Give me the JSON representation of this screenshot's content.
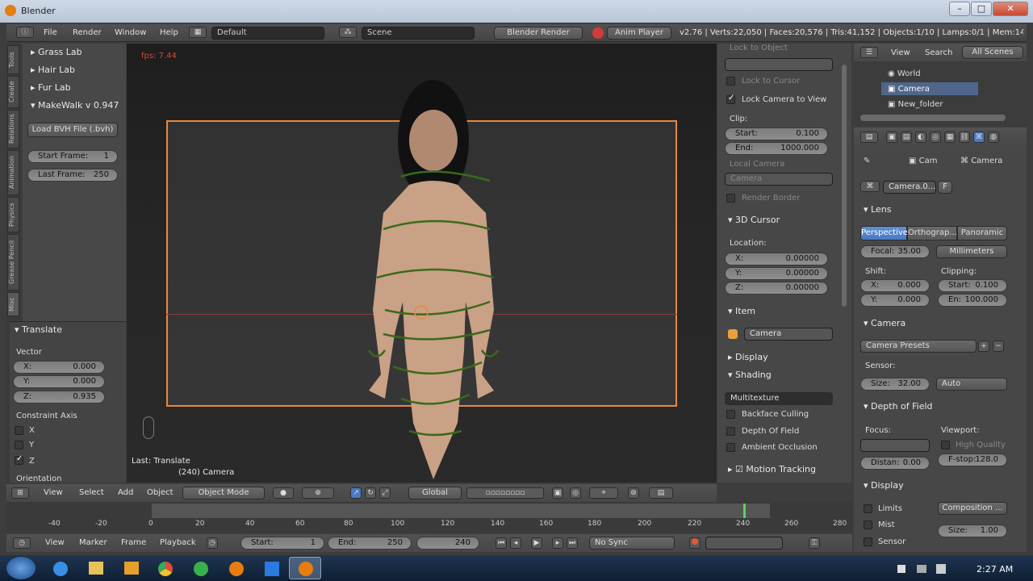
{
  "window": {
    "title": "Blender",
    "controls": [
      "–",
      "□",
      "✕"
    ]
  },
  "infobar": {
    "menus": [
      "File",
      "Render",
      "Window",
      "Help"
    ],
    "screen": "Default",
    "scene": "Scene",
    "engine": "Blender Render",
    "anim_player": "Anim Player",
    "stats": "v2.76 | Verts:22,050 | Faces:20,576 | Tris:41,152 | Objects:1/10 | Lamps:0/1 | Mem:14"
  },
  "tool_tabs": [
    "Tools",
    "Create",
    "Relations",
    "Animation",
    "Physics",
    "Grease Pencil",
    "Misc"
  ],
  "toolshelf": {
    "panels": [
      "Grass Lab",
      "Hair Lab",
      "Fur Lab",
      "MakeWalk v 0.947"
    ],
    "load_bvh": "Load BVH File (.bvh)",
    "start_frame_label": "Start Frame:",
    "start_frame": "1",
    "last_frame_label": "Last Frame:",
    "last_frame": "250"
  },
  "operator": {
    "title": "Translate",
    "vector_label": "Vector",
    "x_label": "X:",
    "x": "0.000",
    "y_label": "Y:",
    "y": "0.000",
    "z_label": "Z:",
    "z": "0.935",
    "constraint_label": "Constraint Axis",
    "axes": [
      "X",
      "Y",
      "Z"
    ],
    "orientation_label": "Orientation"
  },
  "viewport": {
    "fps": "fps: 7.44",
    "last_op": "Last: Translate",
    "object_label": "(240) Camera"
  },
  "view_header": {
    "menus": [
      "View",
      "Select",
      "Add",
      "Object"
    ],
    "mode": "Object Mode",
    "orientation": "Global"
  },
  "npanel": {
    "lock_to_object": "Lock to Object",
    "lock_to_cursor": "Lock to Cursor",
    "lock_camera": "Lock Camera to View",
    "clip_label": "Clip:",
    "start_label": "Start:",
    "start": "0.100",
    "end_label": "End:",
    "end": "1000.000",
    "local_camera": "Local Camera",
    "camera_field": "Camera",
    "render_border": "Render Border",
    "cursor_title": "3D Cursor",
    "location_label": "Location:",
    "cx_label": "X:",
    "cx": "0.00000",
    "cy_label": "Y:",
    "cy": "0.00000",
    "cz_label": "Z:",
    "cz": "0.00000",
    "item_title": "Item",
    "item_name": "Camera",
    "display_title": "Display",
    "shading_title": "Shading",
    "shading_mode": "Multitexture",
    "backface": "Backface Culling",
    "dof": "Depth Of Field",
    "ao": "Ambient Occlusion",
    "motion": "Motion Tracking"
  },
  "outliner": {
    "menus": [
      "View",
      "Search"
    ],
    "scope": "All Scenes",
    "items": [
      "World",
      "Camera",
      "New_folder"
    ]
  },
  "props": {
    "breadcrumb_obj": "Cam",
    "breadcrumb_data": "Camera",
    "datablock": "Camera.0...",
    "fake_user": "F",
    "lens_title": "Lens",
    "lens_types": [
      "Perspective",
      "Orthograp...",
      "Panoramic"
    ],
    "focal_label": "Focal:",
    "focal": "35.00",
    "lens_unit": "Millimeters",
    "shift_label": "Shift:",
    "clipping_label": "Clipping:",
    "sx_label": "X:",
    "sx": "0.000",
    "sy_label": "Y:",
    "sy": "0.000",
    "clip_start_label": "Start:",
    "clip_start": "0.100",
    "clip_end_label": "En:",
    "clip_end": "100.000",
    "camera_title": "Camera",
    "presets": "Camera Presets",
    "sensor_label": "Sensor:",
    "size_label": "Size:",
    "size": "32.00",
    "sensor_fit": "Auto",
    "dof_title": "Depth of Field",
    "focus_label": "Focus:",
    "viewport_label": "Viewport:",
    "high_quality": "High Quality",
    "distance_label": "Distan:",
    "distance": "0.00",
    "fstop_label": "F-stop:",
    "fstop": "128.0",
    "display_title": "Display",
    "limits": "Limits",
    "mist": "Mist",
    "sensor_chk": "Sensor",
    "composition": "Composition ...",
    "disp_size_label": "Size:",
    "disp_size": "1.00"
  },
  "timeline": {
    "ticks": [
      "-40",
      "-20",
      "0",
      "20",
      "40",
      "60",
      "80",
      "100",
      "120",
      "140",
      "160",
      "180",
      "200",
      "220",
      "240",
      "260",
      "280"
    ],
    "menus": [
      "View",
      "Marker",
      "Frame",
      "Playback"
    ],
    "start_label": "Start:",
    "start": "1",
    "end_label": "End:",
    "end": "250",
    "current": "240",
    "sync": "No Sync"
  },
  "taskbar": {
    "time": "2:27 AM"
  },
  "colors": {
    "accent": "#5680c2",
    "orange": "#e87d0d",
    "selected_outline": "#e8883a"
  }
}
